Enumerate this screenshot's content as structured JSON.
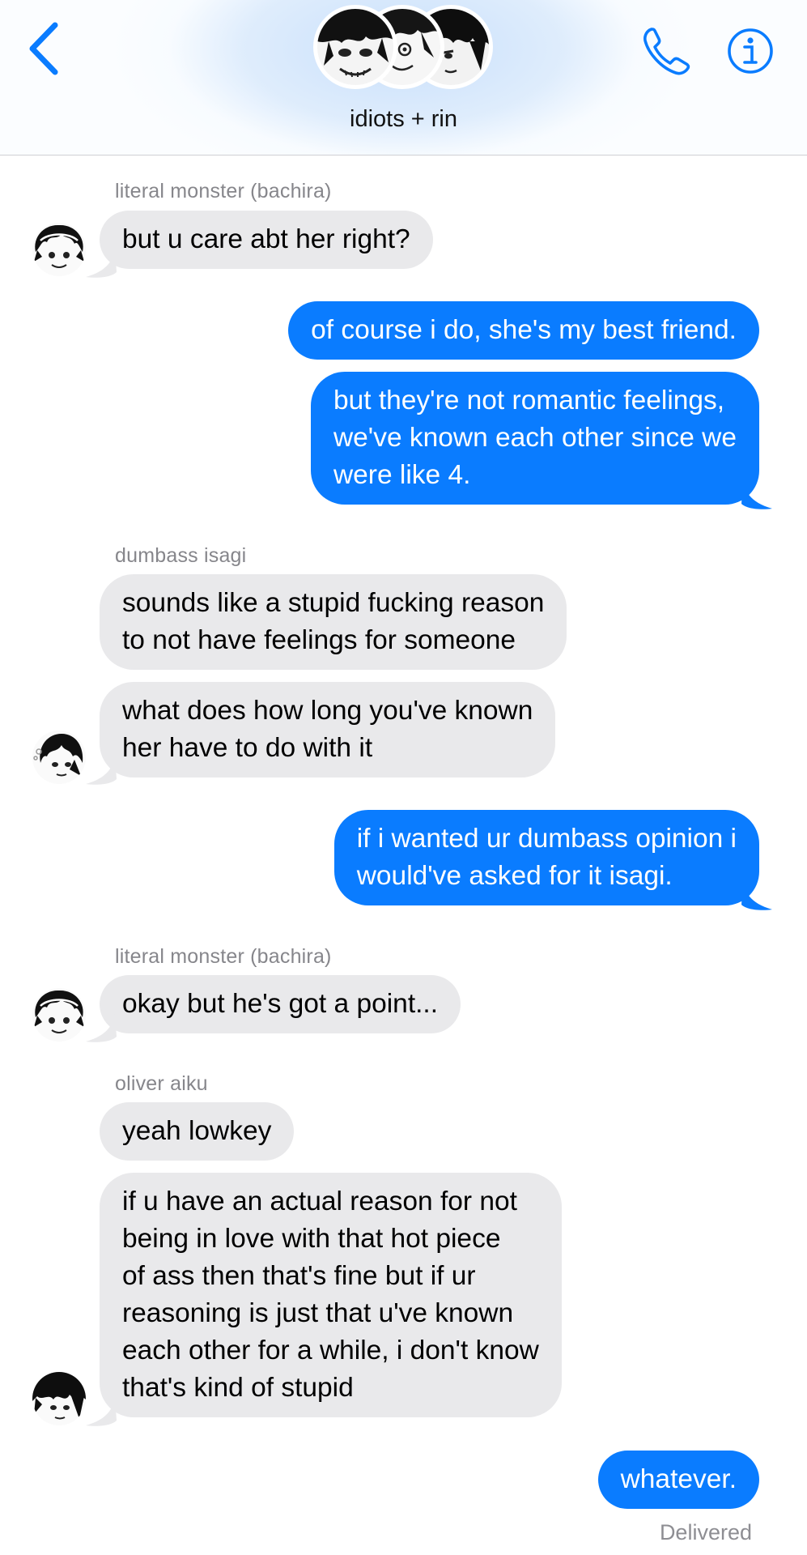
{
  "header": {
    "title": "idiots + rin",
    "back_icon": "chevron-left-icon",
    "call_icon": "phone-icon",
    "info_icon": "info-icon",
    "accent_color": "#0a7cff"
  },
  "messages": [
    {
      "sender": "literal monster (bachira)",
      "text": "but u care abt her right?"
    },
    {
      "text": "of course i do, she's my best friend."
    },
    {
      "text": "but they're not romantic feelings,\nwe've known each other since we\nwere like 4."
    },
    {
      "sender": "dumbass isagi",
      "text": "sounds like a stupid fucking reason\nto not have feelings for someone"
    },
    {
      "text": "what does how long you've known\nher have to do with it"
    },
    {
      "text": "if i wanted ur dumbass opinion i\nwould've asked for it isagi."
    },
    {
      "sender": "literal monster (bachira)",
      "text": "okay but he's got a point..."
    },
    {
      "sender": "oliver aiku",
      "text": "yeah lowkey"
    },
    {
      "text": "if u have an actual reason for not\nbeing in love with that hot piece\nof ass then that's fine but if ur\nreasoning is just that u've known\neach other for a while, i don't know\nthat's kind of stupid"
    },
    {
      "text": "whatever."
    }
  ],
  "status": "Delivered",
  "colors": {
    "incoming_bubble": "#e9e9eb",
    "outgoing_bubble": "#0a7cff",
    "sender_label": "#86868b"
  }
}
